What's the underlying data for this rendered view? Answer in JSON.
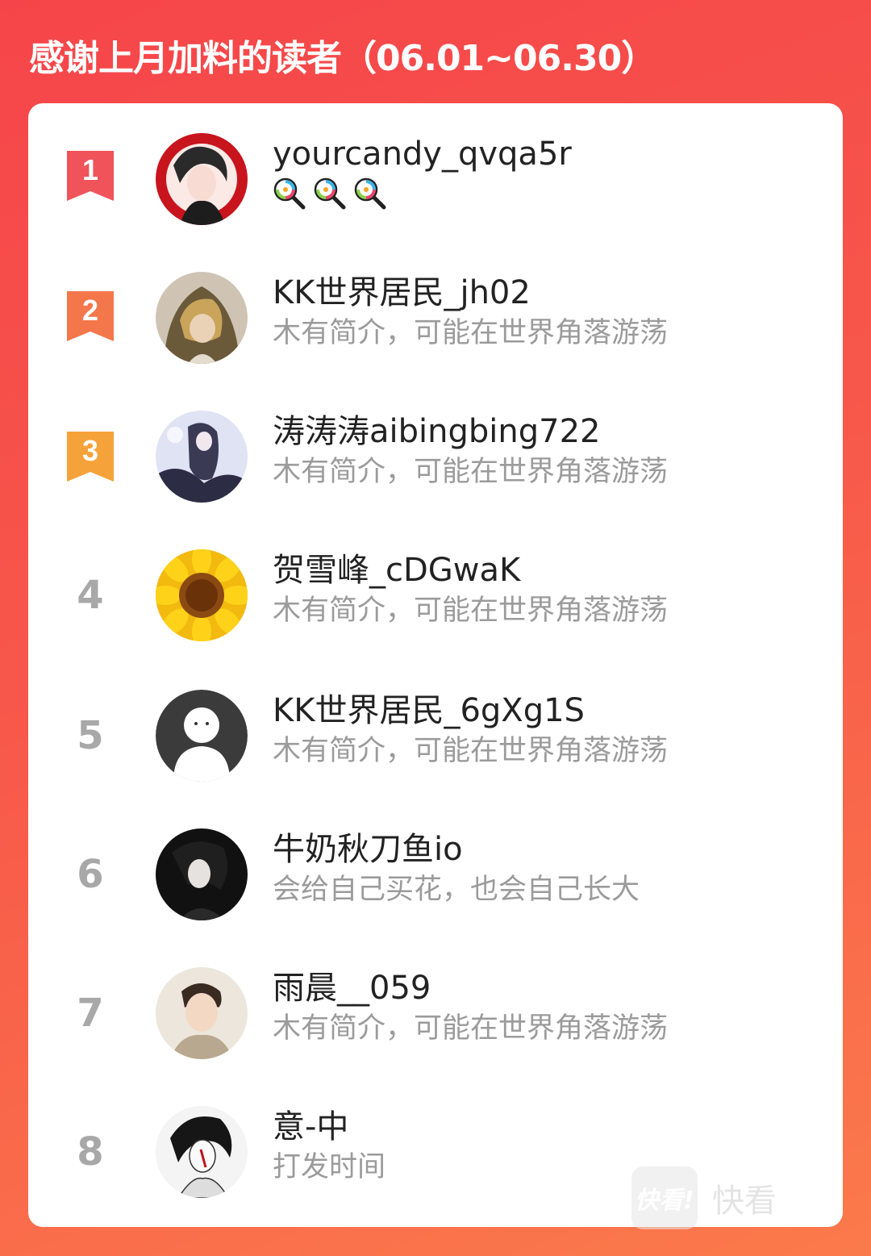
{
  "header": {
    "title": "感谢上月加料的读者（06.01~06.30）"
  },
  "readers": [
    {
      "rank": "1",
      "name": "yourcandy_qvqa5r",
      "bio": "",
      "badge_color": "#f0535a",
      "avatar_icon": "anime-girl-avatar"
    },
    {
      "rank": "2",
      "name": "KK世界居民_jh02",
      "bio": "木有简介，可能在世界角落游荡",
      "badge_color": "#f4774c",
      "avatar_icon": "hooded-anime-avatar"
    },
    {
      "rank": "3",
      "name": "涛涛涛aibingbing722",
      "bio": "木有简介，可能在世界角落游荡",
      "badge_color": "#f6a23a",
      "avatar_icon": "anime-illustration-avatar"
    },
    {
      "rank": "4",
      "name": "贺雪峰_cDGwaK",
      "bio": "木有简介，可能在世界角落游荡",
      "badge_color": "",
      "avatar_icon": "sunflower-avatar"
    },
    {
      "rank": "5",
      "name": "KK世界居民_6gXg1S",
      "bio": "木有简介，可能在世界角落游荡",
      "badge_color": "",
      "avatar_icon": "default-user-avatar"
    },
    {
      "rank": "6",
      "name": "牛奶秋刀鱼io",
      "bio": "会给自己买花，也会自己长大",
      "badge_color": "",
      "avatar_icon": "dark-anime-avatar"
    },
    {
      "rank": "7",
      "name": "雨晨__059",
      "bio": "木有简介，可能在世界角落游荡",
      "badge_color": "",
      "avatar_icon": "photo-portrait-avatar"
    },
    {
      "rank": "8",
      "name": "意-中",
      "bio": "打发时间",
      "badge_color": "",
      "avatar_icon": "sketch-anime-avatar"
    }
  ],
  "first_reader_badges": [
    "lollipop-icon",
    "lollipop-icon",
    "lollipop-icon"
  ],
  "watermark": {
    "logo_text": "快看!",
    "text": "快看"
  }
}
